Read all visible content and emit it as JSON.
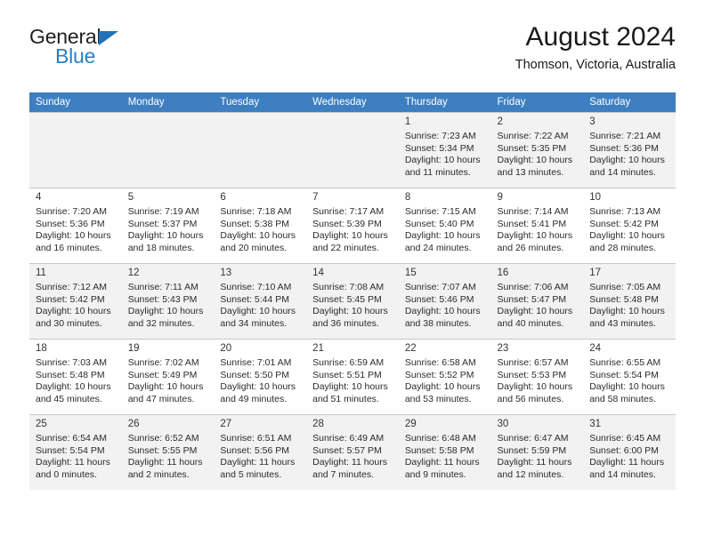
{
  "brand": {
    "name_part1": "General",
    "name_part2": "Blue",
    "triangle_color": "#1f72bb",
    "blue_color": "#2581c4"
  },
  "header": {
    "title": "August 2024",
    "subtitle": "Thomson, Victoria, Australia"
  },
  "theme": {
    "header_row_bg": "#3d7fc1",
    "header_row_text": "#ffffff",
    "shaded_row_bg": "#f2f2f2",
    "grid_line": "#c8c8c8"
  },
  "weekdays": [
    "Sunday",
    "Monday",
    "Tuesday",
    "Wednesday",
    "Thursday",
    "Friday",
    "Saturday"
  ],
  "weeks": [
    [
      {
        "day": "",
        "sunrise": "",
        "sunset": "",
        "daylight_line1": "",
        "daylight_line2": ""
      },
      {
        "day": "",
        "sunrise": "",
        "sunset": "",
        "daylight_line1": "",
        "daylight_line2": ""
      },
      {
        "day": "",
        "sunrise": "",
        "sunset": "",
        "daylight_line1": "",
        "daylight_line2": ""
      },
      {
        "day": "",
        "sunrise": "",
        "sunset": "",
        "daylight_line1": "",
        "daylight_line2": ""
      },
      {
        "day": "1",
        "sunrise": "Sunrise: 7:23 AM",
        "sunset": "Sunset: 5:34 PM",
        "daylight_line1": "Daylight: 10 hours",
        "daylight_line2": "and 11 minutes."
      },
      {
        "day": "2",
        "sunrise": "Sunrise: 7:22 AM",
        "sunset": "Sunset: 5:35 PM",
        "daylight_line1": "Daylight: 10 hours",
        "daylight_line2": "and 13 minutes."
      },
      {
        "day": "3",
        "sunrise": "Sunrise: 7:21 AM",
        "sunset": "Sunset: 5:36 PM",
        "daylight_line1": "Daylight: 10 hours",
        "daylight_line2": "and 14 minutes."
      }
    ],
    [
      {
        "day": "4",
        "sunrise": "Sunrise: 7:20 AM",
        "sunset": "Sunset: 5:36 PM",
        "daylight_line1": "Daylight: 10 hours",
        "daylight_line2": "and 16 minutes."
      },
      {
        "day": "5",
        "sunrise": "Sunrise: 7:19 AM",
        "sunset": "Sunset: 5:37 PM",
        "daylight_line1": "Daylight: 10 hours",
        "daylight_line2": "and 18 minutes."
      },
      {
        "day": "6",
        "sunrise": "Sunrise: 7:18 AM",
        "sunset": "Sunset: 5:38 PM",
        "daylight_line1": "Daylight: 10 hours",
        "daylight_line2": "and 20 minutes."
      },
      {
        "day": "7",
        "sunrise": "Sunrise: 7:17 AM",
        "sunset": "Sunset: 5:39 PM",
        "daylight_line1": "Daylight: 10 hours",
        "daylight_line2": "and 22 minutes."
      },
      {
        "day": "8",
        "sunrise": "Sunrise: 7:15 AM",
        "sunset": "Sunset: 5:40 PM",
        "daylight_line1": "Daylight: 10 hours",
        "daylight_line2": "and 24 minutes."
      },
      {
        "day": "9",
        "sunrise": "Sunrise: 7:14 AM",
        "sunset": "Sunset: 5:41 PM",
        "daylight_line1": "Daylight: 10 hours",
        "daylight_line2": "and 26 minutes."
      },
      {
        "day": "10",
        "sunrise": "Sunrise: 7:13 AM",
        "sunset": "Sunset: 5:42 PM",
        "daylight_line1": "Daylight: 10 hours",
        "daylight_line2": "and 28 minutes."
      }
    ],
    [
      {
        "day": "11",
        "sunrise": "Sunrise: 7:12 AM",
        "sunset": "Sunset: 5:42 PM",
        "daylight_line1": "Daylight: 10 hours",
        "daylight_line2": "and 30 minutes."
      },
      {
        "day": "12",
        "sunrise": "Sunrise: 7:11 AM",
        "sunset": "Sunset: 5:43 PM",
        "daylight_line1": "Daylight: 10 hours",
        "daylight_line2": "and 32 minutes."
      },
      {
        "day": "13",
        "sunrise": "Sunrise: 7:10 AM",
        "sunset": "Sunset: 5:44 PM",
        "daylight_line1": "Daylight: 10 hours",
        "daylight_line2": "and 34 minutes."
      },
      {
        "day": "14",
        "sunrise": "Sunrise: 7:08 AM",
        "sunset": "Sunset: 5:45 PM",
        "daylight_line1": "Daylight: 10 hours",
        "daylight_line2": "and 36 minutes."
      },
      {
        "day": "15",
        "sunrise": "Sunrise: 7:07 AM",
        "sunset": "Sunset: 5:46 PM",
        "daylight_line1": "Daylight: 10 hours",
        "daylight_line2": "and 38 minutes."
      },
      {
        "day": "16",
        "sunrise": "Sunrise: 7:06 AM",
        "sunset": "Sunset: 5:47 PM",
        "daylight_line1": "Daylight: 10 hours",
        "daylight_line2": "and 40 minutes."
      },
      {
        "day": "17",
        "sunrise": "Sunrise: 7:05 AM",
        "sunset": "Sunset: 5:48 PM",
        "daylight_line1": "Daylight: 10 hours",
        "daylight_line2": "and 43 minutes."
      }
    ],
    [
      {
        "day": "18",
        "sunrise": "Sunrise: 7:03 AM",
        "sunset": "Sunset: 5:48 PM",
        "daylight_line1": "Daylight: 10 hours",
        "daylight_line2": "and 45 minutes."
      },
      {
        "day": "19",
        "sunrise": "Sunrise: 7:02 AM",
        "sunset": "Sunset: 5:49 PM",
        "daylight_line1": "Daylight: 10 hours",
        "daylight_line2": "and 47 minutes."
      },
      {
        "day": "20",
        "sunrise": "Sunrise: 7:01 AM",
        "sunset": "Sunset: 5:50 PM",
        "daylight_line1": "Daylight: 10 hours",
        "daylight_line2": "and 49 minutes."
      },
      {
        "day": "21",
        "sunrise": "Sunrise: 6:59 AM",
        "sunset": "Sunset: 5:51 PM",
        "daylight_line1": "Daylight: 10 hours",
        "daylight_line2": "and 51 minutes."
      },
      {
        "day": "22",
        "sunrise": "Sunrise: 6:58 AM",
        "sunset": "Sunset: 5:52 PM",
        "daylight_line1": "Daylight: 10 hours",
        "daylight_line2": "and 53 minutes."
      },
      {
        "day": "23",
        "sunrise": "Sunrise: 6:57 AM",
        "sunset": "Sunset: 5:53 PM",
        "daylight_line1": "Daylight: 10 hours",
        "daylight_line2": "and 56 minutes."
      },
      {
        "day": "24",
        "sunrise": "Sunrise: 6:55 AM",
        "sunset": "Sunset: 5:54 PM",
        "daylight_line1": "Daylight: 10 hours",
        "daylight_line2": "and 58 minutes."
      }
    ],
    [
      {
        "day": "25",
        "sunrise": "Sunrise: 6:54 AM",
        "sunset": "Sunset: 5:54 PM",
        "daylight_line1": "Daylight: 11 hours",
        "daylight_line2": "and 0 minutes."
      },
      {
        "day": "26",
        "sunrise": "Sunrise: 6:52 AM",
        "sunset": "Sunset: 5:55 PM",
        "daylight_line1": "Daylight: 11 hours",
        "daylight_line2": "and 2 minutes."
      },
      {
        "day": "27",
        "sunrise": "Sunrise: 6:51 AM",
        "sunset": "Sunset: 5:56 PM",
        "daylight_line1": "Daylight: 11 hours",
        "daylight_line2": "and 5 minutes."
      },
      {
        "day": "28",
        "sunrise": "Sunrise: 6:49 AM",
        "sunset": "Sunset: 5:57 PM",
        "daylight_line1": "Daylight: 11 hours",
        "daylight_line2": "and 7 minutes."
      },
      {
        "day": "29",
        "sunrise": "Sunrise: 6:48 AM",
        "sunset": "Sunset: 5:58 PM",
        "daylight_line1": "Daylight: 11 hours",
        "daylight_line2": "and 9 minutes."
      },
      {
        "day": "30",
        "sunrise": "Sunrise: 6:47 AM",
        "sunset": "Sunset: 5:59 PM",
        "daylight_line1": "Daylight: 11 hours",
        "daylight_line2": "and 12 minutes."
      },
      {
        "day": "31",
        "sunrise": "Sunrise: 6:45 AM",
        "sunset": "Sunset: 6:00 PM",
        "daylight_line1": "Daylight: 11 hours",
        "daylight_line2": "and 14 minutes."
      }
    ]
  ]
}
